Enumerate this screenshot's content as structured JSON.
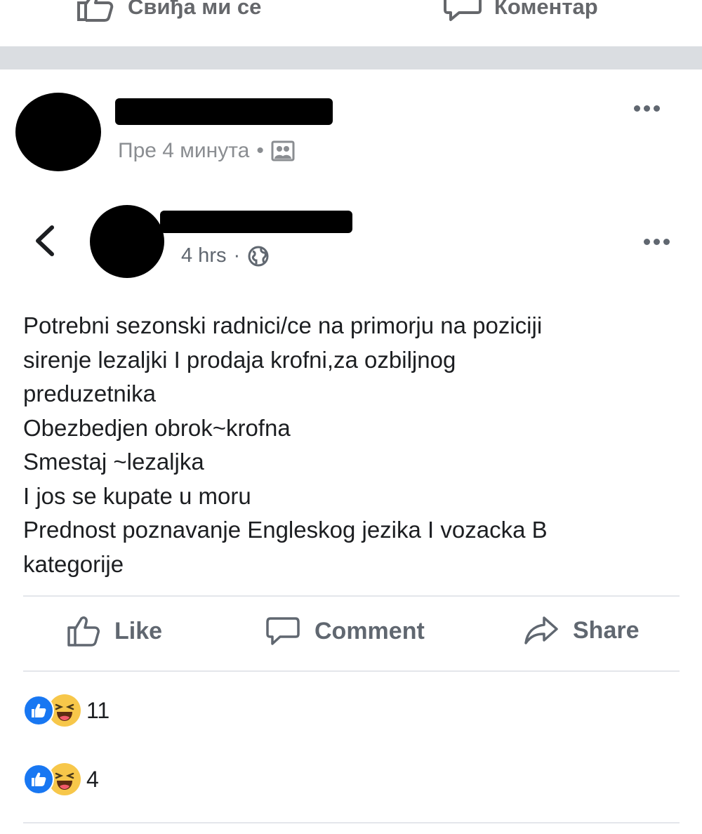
{
  "top_bar": {
    "like_label": "Свиђа ми се",
    "comment_label": "Коментар"
  },
  "outer_post": {
    "timestamp": "Пре 4 минута",
    "separator_dot": "•",
    "privacy_icon": "friends-photo-icon"
  },
  "shared_post": {
    "timestamp": "4 hrs",
    "separator_dot": "·",
    "privacy_icon": "globe-icon",
    "text_lines": [
      "Potrebni sezonski radnici/ce na primorju na poziciji",
      "sirenje lezaljki I prodaja krofni,za ozbiljnog",
      "preduzetnika",
      "Obezbedjen obrok~krofna",
      "Smestaj ~lezaljka",
      "I jos se kupate u moru",
      "Prednost poznavanje Engleskog jezika I vozacka B",
      "kategorije"
    ]
  },
  "actions": {
    "like_label": "Like",
    "comment_label": "Comment",
    "share_label": "Share"
  },
  "reactions": [
    {
      "count": "11"
    },
    {
      "count": "4"
    }
  ],
  "colors": {
    "accent_blue": "#1877f2",
    "haha_yellow": "#f7c74a",
    "muted_text": "#606770",
    "separator": "#dadde1"
  }
}
